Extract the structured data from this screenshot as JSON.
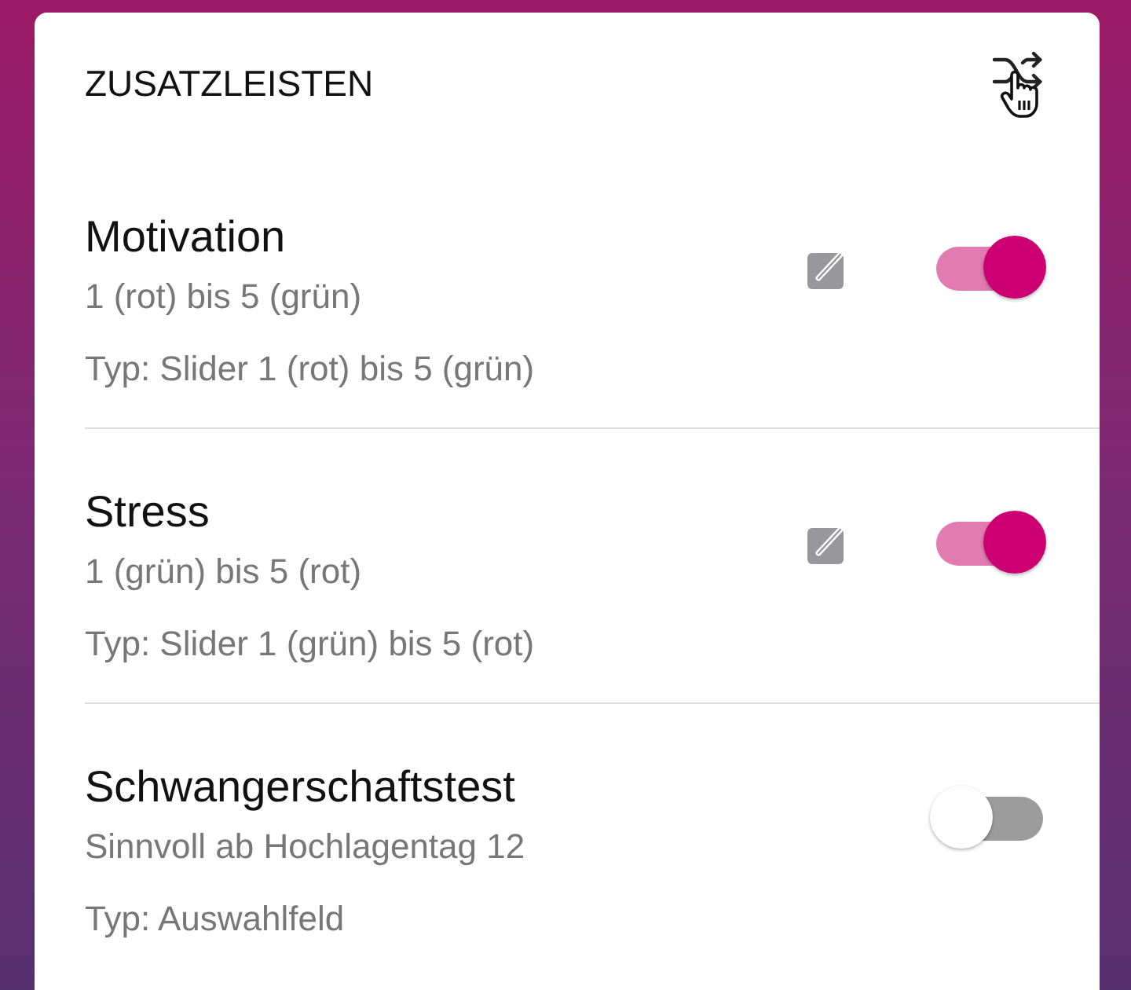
{
  "panel": {
    "title": "ZUSATZLEISTEN"
  },
  "items": [
    {
      "name": "Motivation",
      "description": "1 (rot) bis 5 (grün)",
      "type": "Typ: Slider 1 (rot) bis 5 (grün)",
      "editable": true,
      "on": true
    },
    {
      "name": "Stress",
      "description": "1 (grün) bis 5 (rot)",
      "type": "Typ: Slider 1 (grün) bis 5 (rot)",
      "editable": true,
      "on": true
    },
    {
      "name": "Schwangerschaftstest",
      "description": "Sinnvoll ab Hochlagentag 12",
      "type": "Typ: Auswahlfeld",
      "editable": false,
      "on": false
    }
  ]
}
